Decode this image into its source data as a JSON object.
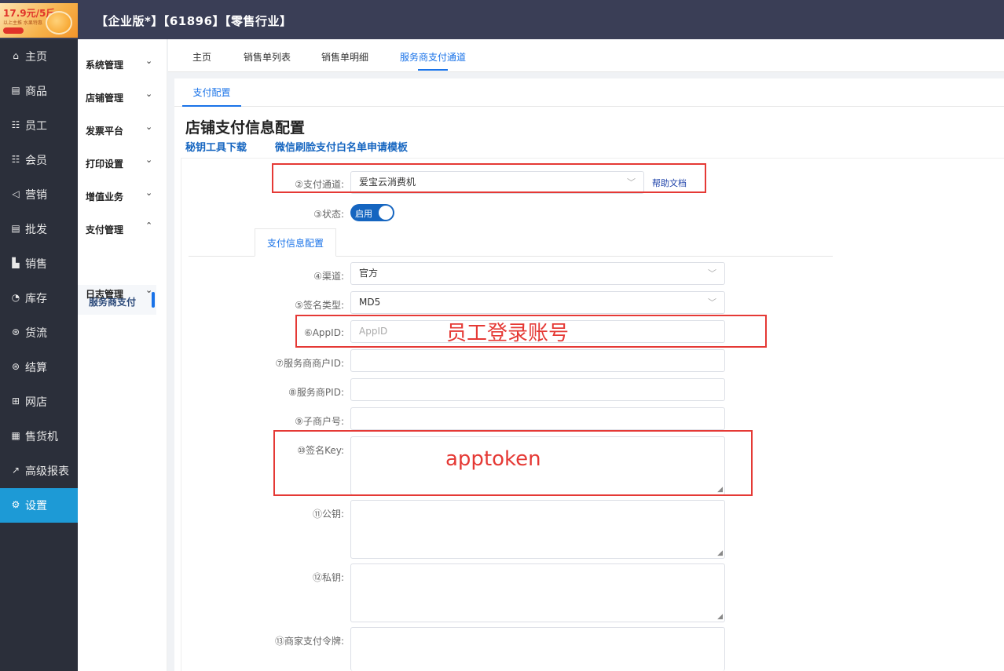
{
  "header": {
    "title": "【企业版*】【61896】【零售行业】",
    "logo_price": "17.9元/5斤",
    "logo_sub": "以上主推 水果特惠"
  },
  "sidebar": {
    "items": [
      {
        "icon": "home-icon",
        "glyph": "⌂",
        "label": "主页"
      },
      {
        "icon": "product-icon",
        "glyph": "▤",
        "label": "商品"
      },
      {
        "icon": "staff-icon",
        "glyph": "☷",
        "label": "员工"
      },
      {
        "icon": "member-icon",
        "glyph": "☷",
        "label": "会员"
      },
      {
        "icon": "marketing-icon",
        "glyph": "◁",
        "label": "营销"
      },
      {
        "icon": "wholesale-icon",
        "glyph": "▤",
        "label": "批发"
      },
      {
        "icon": "sales-icon",
        "glyph": "▙",
        "label": "销售"
      },
      {
        "icon": "inventory-icon",
        "glyph": "◔",
        "label": "库存"
      },
      {
        "icon": "logistics-icon",
        "glyph": "⊛",
        "label": "货流"
      },
      {
        "icon": "settlement-icon",
        "glyph": "⊛",
        "label": "结算"
      },
      {
        "icon": "online-store-icon",
        "glyph": "⊞",
        "label": "网店"
      },
      {
        "icon": "vending-icon",
        "glyph": "▦",
        "label": "售货机"
      },
      {
        "icon": "report-icon",
        "glyph": "↗",
        "label": "高级报表"
      },
      {
        "icon": "settings-icon",
        "glyph": "⚙",
        "label": "设置"
      }
    ],
    "active_index": 13
  },
  "subsidebar": {
    "items": [
      {
        "label": "系统管理",
        "chev": "⌄"
      },
      {
        "label": "店铺管理",
        "chev": "⌄"
      },
      {
        "label": "发票平台",
        "chev": "⌄"
      },
      {
        "label": "打印设置",
        "chev": "⌄"
      },
      {
        "label": "增值业务",
        "chev": "⌄"
      },
      {
        "label": "支付管理",
        "chev": "⌃"
      },
      {
        "label": "日志管理",
        "chev": "⌄"
      }
    ],
    "child": "服务商支付"
  },
  "tabs": [
    "主页",
    "销售单列表",
    "销售单明细",
    "服务商支付通道"
  ],
  "subtab": "支付配置",
  "page": {
    "title": "店铺支付信息配置",
    "link_tool": "秘钥工具下载",
    "link_template": "微信刷脸支付白名单申请模板",
    "help": "帮助文档",
    "inner_tab": "支付信息配置",
    "toggle_label": "启用"
  },
  "form": {
    "channel_label": "②支付通道:",
    "channel_value": "爱宝云消费机",
    "status_label": "③状态:",
    "route_label": "④渠道:",
    "route_value": "官方",
    "sign_type_label": "⑤签名类型:",
    "sign_type_value": "MD5",
    "appid_label": "⑥AppID:",
    "appid_placeholder": "AppID",
    "merchant_id_label": "⑦服务商商户ID:",
    "pid_label": "⑧服务商PID:",
    "sub_merchant_label": "⑨子商户号:",
    "sign_key_label": "⑩签名Key:",
    "public_key_label": "⑪公钥:",
    "private_key_label": "⑫私钥:",
    "token_label": "⑬商家支付令牌:"
  },
  "annotations": {
    "appid_note": "员工登录账号",
    "signkey_note": "apptoken"
  }
}
